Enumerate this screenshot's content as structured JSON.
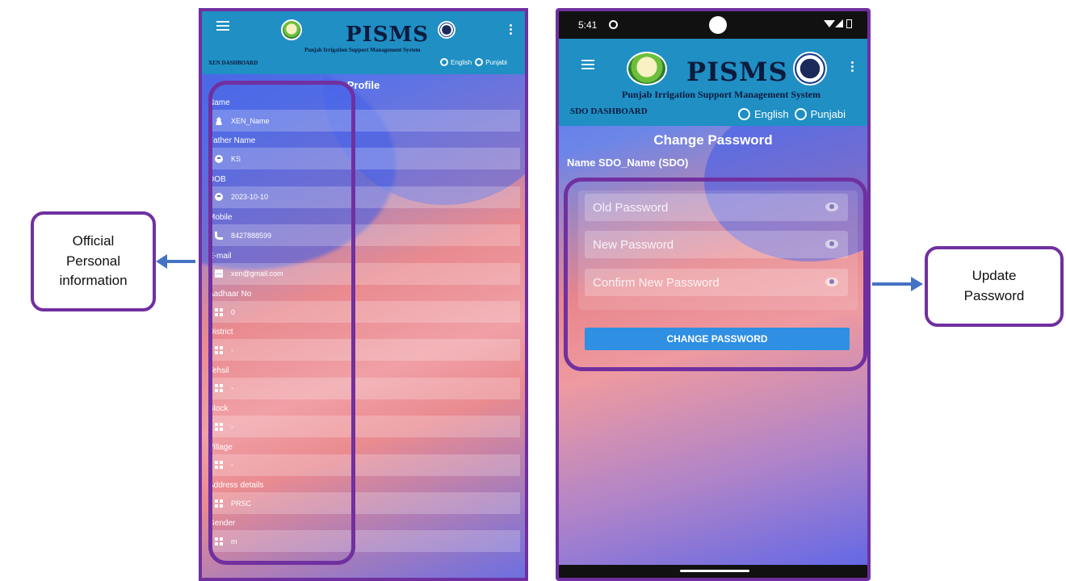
{
  "callouts": {
    "left": "Official\nPersonal\ninformation",
    "right": "Update\nPassword"
  },
  "app": {
    "title": "PISMS",
    "subtitle": "Punjab Irrigation Support Management System",
    "lang_english": "English",
    "lang_punjabi": "Punjabi",
    "selected_language": "English"
  },
  "profile_screen": {
    "dashboard": "XEN DASHBOARD",
    "title": "Profile",
    "fields": [
      {
        "label": "Name",
        "value": "XEN_Name",
        "icon": "person-icon"
      },
      {
        "label": "Father Name",
        "value": "KS",
        "icon": "face-icon"
      },
      {
        "label": "DOB",
        "value": "2023-10-10",
        "icon": "face-icon"
      },
      {
        "label": "Mobile",
        "value": "8427888599",
        "icon": "phone-icon"
      },
      {
        "label": "E-mail",
        "value": "xen@gmail.com",
        "icon": "mail-icon"
      },
      {
        "label": "Aadhaar No",
        "value": "0",
        "icon": "grid-icon"
      },
      {
        "label": "District",
        "value": "-",
        "icon": "grid-icon"
      },
      {
        "label": "Tehsil",
        "value": "-",
        "icon": "grid-icon"
      },
      {
        "label": "Block",
        "value": "-",
        "icon": "grid-icon"
      },
      {
        "label": "Village",
        "value": "-",
        "icon": "grid-icon"
      },
      {
        "label": "Address details",
        "value": "PRSC",
        "icon": "grid-icon"
      },
      {
        "label": "Gender",
        "value": "m",
        "icon": "grid-icon"
      }
    ]
  },
  "password_screen": {
    "status_time": "5:41",
    "dashboard": "SDO DASHBOARD",
    "title": "Change Password",
    "name_line": "Name SDO_Name (SDO)",
    "old_password_placeholder": "Old Password",
    "new_password_placeholder": "New Password",
    "confirm_password_placeholder": "Confirm New Password",
    "button_label": "CHANGE PASSWORD"
  },
  "colors": {
    "accent_purple": "#7030a0",
    "header_blue": "#1f8fc4",
    "arrow_blue": "#4472c4",
    "button_blue": "#2f8fe3"
  }
}
